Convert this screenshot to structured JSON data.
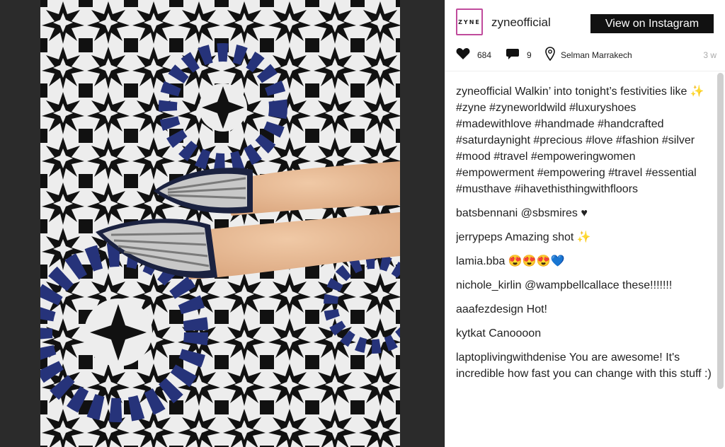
{
  "post": {
    "username": "zyneofficial",
    "avatar_text": "ZYNE",
    "view_button_label": "View on Instagram",
    "likes": "684",
    "comments_count": "9",
    "location": "Selman Marrakech",
    "time_ago": "3 w",
    "caption_user": "zyneofficial",
    "caption_text": "Walkin’ into tonight’s festivities like ✨",
    "caption_tags": "#zyne #zyneworldwild #luxuryshoes #madewithlove #handmade #handcrafted #saturdaynight #precious #love #fashion #silver #mood #travel #empoweringwomen #empowerment #empowering #travel #essential #musthave #ihavethisthingwithfloors"
  },
  "comments": [
    {
      "user": "batsbennani",
      "text": "@sbsmires ♥"
    },
    {
      "user": "jerrypeps",
      "text": "Amazing shot ✨"
    },
    {
      "user": "lamia.bba",
      "text": "😍😍😍💙"
    },
    {
      "user": "nichole_kirlin",
      "text": "@wampbellcallace these!!!!!!!"
    },
    {
      "user": "aaafezdesign",
      "text": "Hot!"
    },
    {
      "user": "kytkat",
      "text": "Canoooon"
    },
    {
      "user": "laptoplivingwithdenise",
      "text": "You are awesome! It's incredible how fast you can change with this stuff :)"
    }
  ],
  "icons": {
    "heart": "heart-icon",
    "comment": "comment-icon",
    "location": "location-pin-icon"
  },
  "colors": {
    "tile_black": "#111111",
    "tile_white": "#eeeeee",
    "tile_blue": "#26337a",
    "button_bg": "#111111"
  }
}
